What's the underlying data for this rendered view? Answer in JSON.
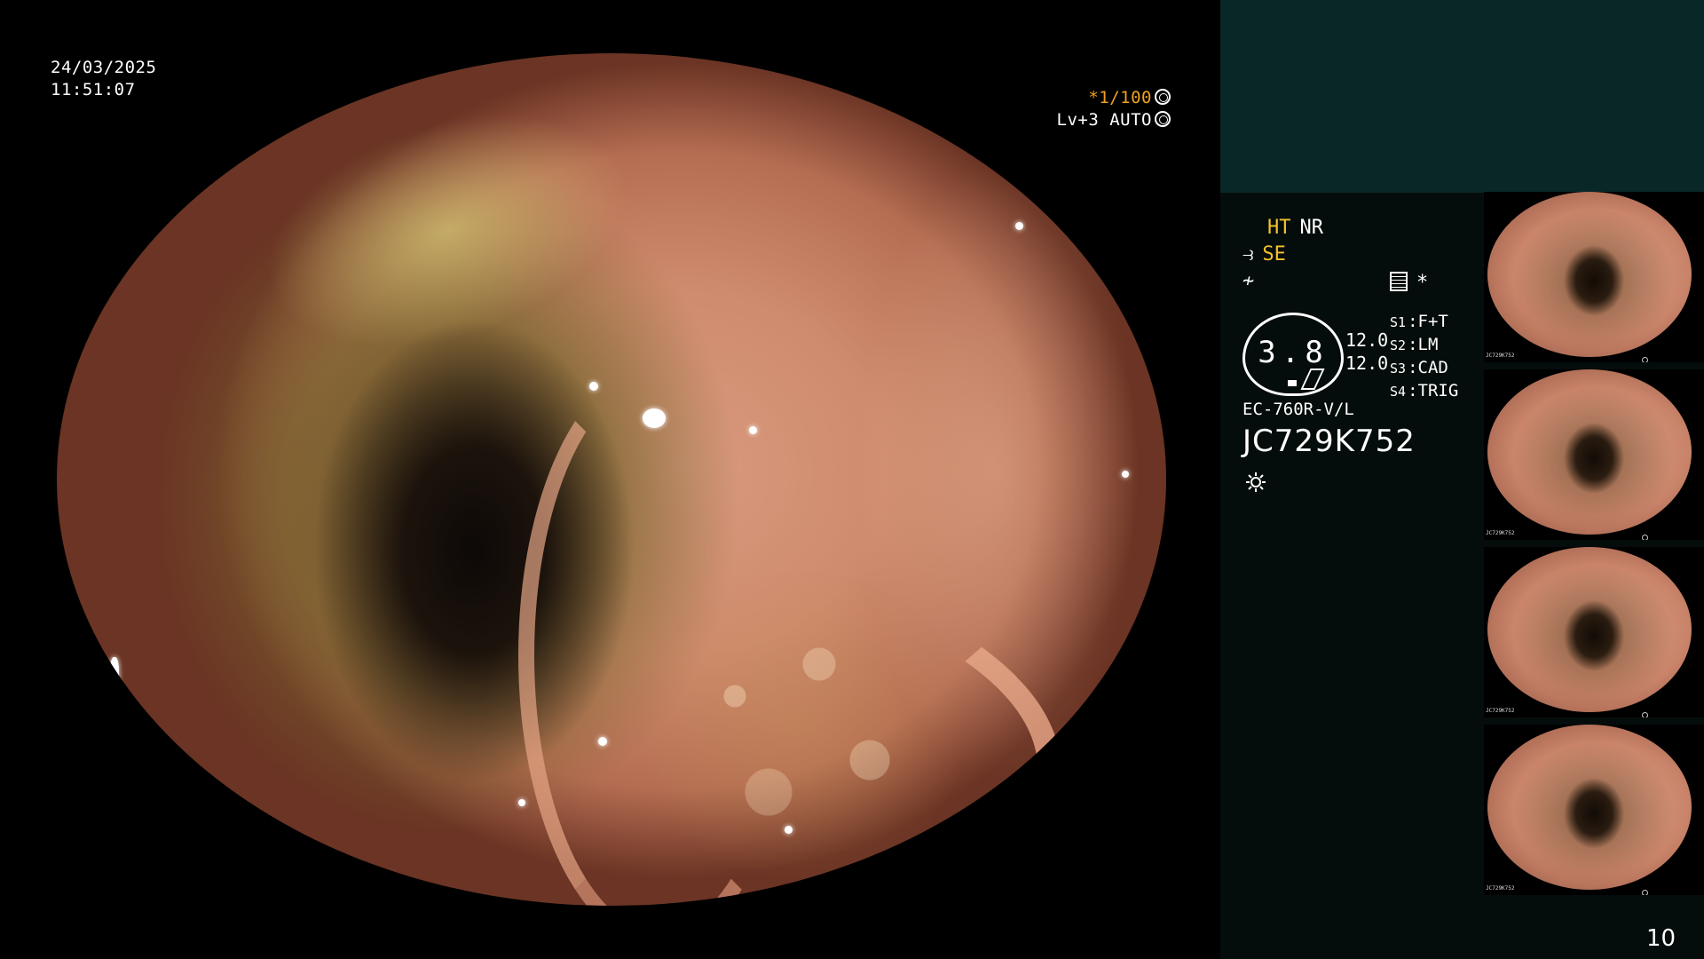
{
  "overlay": {
    "date": "24/03/2025",
    "time": "11:51:07",
    "shutter": "*1/100",
    "level": "Lv+3 AUTO"
  },
  "panel": {
    "mode_ht": "HT",
    "mode_nr": "NR",
    "mode_se": "SE",
    "asterisk": "*",
    "gauge_value": "3.8",
    "gauge_num1": "12.0",
    "gauge_num2": "12.0",
    "switches": [
      {
        "key": "S1",
        "value": "F+T"
      },
      {
        "key": "S2",
        "value": "LM"
      },
      {
        "key": "S3",
        "value": "CAD"
      },
      {
        "key": "S4",
        "value": "TRIG"
      }
    ],
    "scope_model": "EC-760R-V/L",
    "serial": "JC729K752"
  },
  "thumbnails": [
    {
      "serial": "JC729K752"
    },
    {
      "serial": "JC729K752"
    },
    {
      "serial": "JC729K752"
    },
    {
      "serial": "JC729K752"
    }
  ],
  "page_number": "10",
  "colors": {
    "panel_bg": "#040d0b",
    "panel_top": "#0a2727",
    "accent_yellow": "#f5c22c",
    "accent_orange": "#f0a020"
  },
  "icons": [
    "shutter-icon",
    "auto-icon",
    "fan-icon",
    "flash-icon",
    "document-icon",
    "sun-icon"
  ]
}
